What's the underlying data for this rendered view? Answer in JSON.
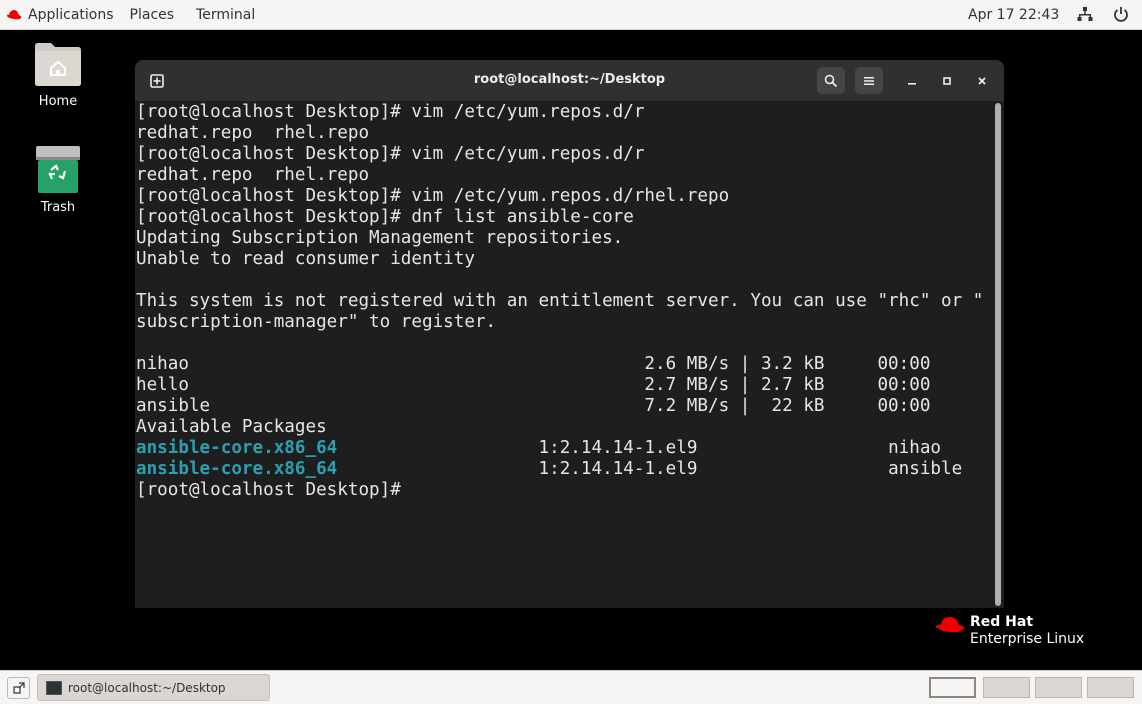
{
  "topbar": {
    "applications": "Applications",
    "places": "Places",
    "terminal": "Terminal",
    "clock": "Apr 17  22:43",
    "icons": [
      "redhat-hat-icon",
      "network-icon",
      "power-icon"
    ]
  },
  "desktop": {
    "home_label": "Home",
    "trash_label": "Trash"
  },
  "terminal": {
    "title": "root@localhost:~/Desktop",
    "lines": [
      {
        "text": "[root@localhost Desktop]# vim /etc/yum.repos.d/r"
      },
      {
        "text": "redhat.repo  rhel.repo"
      },
      {
        "text": "[root@localhost Desktop]# vim /etc/yum.repos.d/r"
      },
      {
        "text": "redhat.repo  rhel.repo"
      },
      {
        "text": "[root@localhost Desktop]# vim /etc/yum.repos.d/rhel.repo"
      },
      {
        "text": "[root@localhost Desktop]# dnf list ansible-core"
      },
      {
        "text": "Updating Subscription Management repositories."
      },
      {
        "text": "Unable to read consumer identity"
      },
      {
        "text": ""
      },
      {
        "text": "This system is not registered with an entitlement server. You can use \"rhc\" or \""
      },
      {
        "text": "subscription-manager\" to register."
      },
      {
        "text": ""
      },
      {
        "text": "nihao                                           2.6 MB/s | 3.2 kB     00:00"
      },
      {
        "text": "hello                                           2.7 MB/s | 2.7 kB     00:00"
      },
      {
        "text": "ansible                                         7.2 MB/s |  22 kB     00:00"
      },
      {
        "text": "Available Packages"
      },
      {
        "pkg": "ansible-core.x86_64",
        "text": "                   1:2.14.14-1.el9                  nihao"
      },
      {
        "pkg": "ansible-core.x86_64",
        "text": "                   1:2.14.14-1.el9                  ansible"
      },
      {
        "text": "[root@localhost Desktop]#"
      }
    ]
  },
  "brand": {
    "line1": "Red Hat",
    "line2": "Enterprise Linux"
  },
  "taskbar": {
    "task_label": "root@localhost:~/Desktop",
    "workspaces": 4,
    "active_workspace": 1
  },
  "colors": {
    "desktop_bg": "#000000",
    "terminal_bg": "#1e1e1e",
    "header_bg": "#303030",
    "package_color": "#2aa1b3",
    "redhat_red": "#ee0000"
  }
}
